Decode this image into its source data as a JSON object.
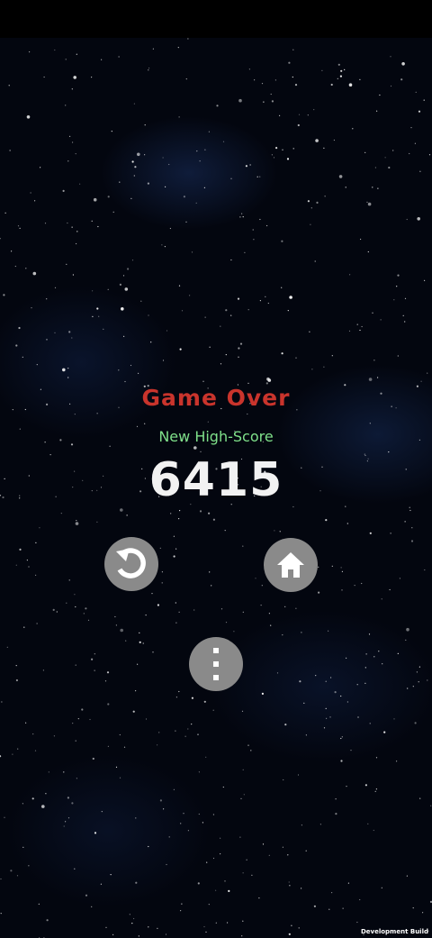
{
  "game_over": {
    "title": "Game Over",
    "subtitle": "New High-Score",
    "score": "6415"
  },
  "buttons": {
    "restart_icon": "restart-icon",
    "home_icon": "home-icon",
    "menu_icon": "more-vertical-icon"
  },
  "footer": {
    "build_label": "Development Build"
  },
  "colors": {
    "title": "#c9342c",
    "subtitle": "#7fe08a",
    "score": "#f2f2f2",
    "button": "#8a8a8a",
    "background": "#03060f"
  }
}
